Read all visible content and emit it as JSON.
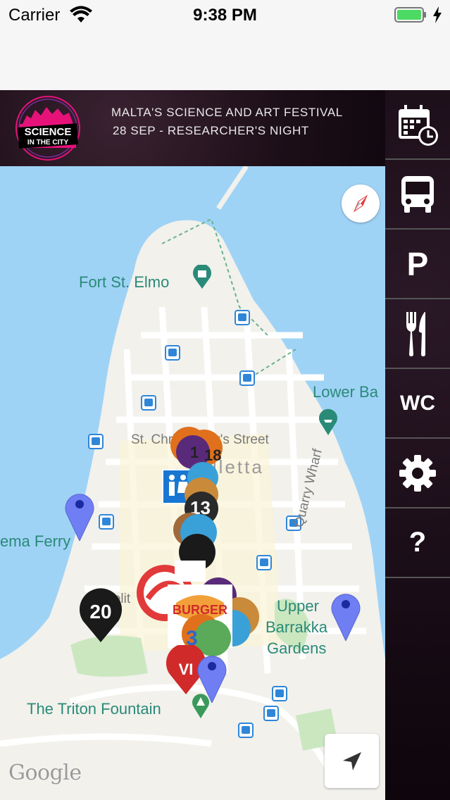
{
  "status_bar": {
    "carrier": "Carrier",
    "time": "9:38 PM"
  },
  "header": {
    "logo_text_line1": "SCIENCE",
    "logo_text_line2": "IN THE CITY",
    "title": "MALTA'S SCIENCE AND ART FESTIVAL",
    "subtitle": "28 SEP - RESEARCHER'S NIGHT"
  },
  "sidebar": {
    "items": [
      {
        "icon": "calendar-clock-icon"
      },
      {
        "icon": "bus-icon"
      },
      {
        "label": "P",
        "icon": "parking-icon"
      },
      {
        "icon": "fork-knife-icon"
      },
      {
        "label": "WC",
        "icon": "wc-icon"
      },
      {
        "icon": "gear-icon"
      },
      {
        "label": "?",
        "icon": "help-icon"
      }
    ]
  },
  "map": {
    "labels": {
      "fort": "Fort St. Elmo",
      "lower_bay": "Lower Ba",
      "street": "St. Christopher's Street",
      "city": "Valletta",
      "ferry": "ema Ferry",
      "quarry": "Quarry Wharf",
      "upper1": "Upper",
      "upper2": "Barrakka",
      "upper3": "Gardens",
      "triton": "The Triton Fountain",
      "melit": "Melit",
      "google": "Google"
    },
    "markers": {
      "m1": "1",
      "m18": "18",
      "m13": "13",
      "m20": "20",
      "m3": "3",
      "vi": "VI"
    }
  },
  "colors": {
    "accent_pink": "#e6127a",
    "water": "#9fd3f6",
    "land": "#f4f3ef",
    "pin_blue": "#6f7ef2"
  }
}
